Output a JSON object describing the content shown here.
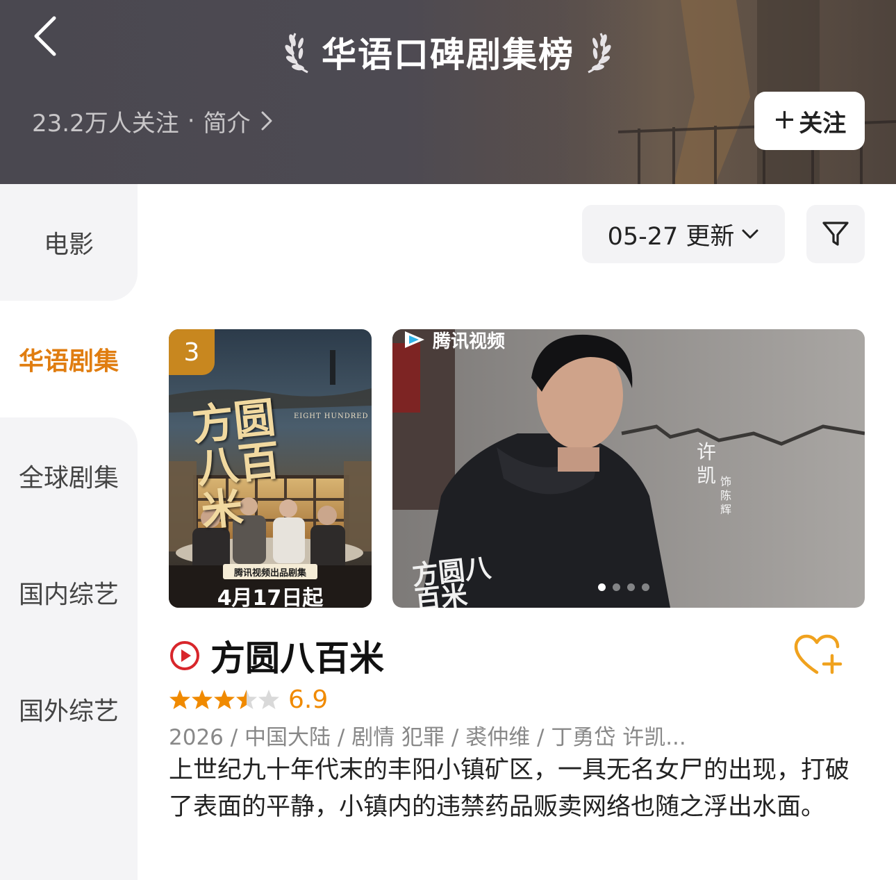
{
  "header": {
    "title": "华语口碑剧集榜",
    "followers": "23.2万人关注",
    "separator": "·",
    "intro_label": "简介",
    "follow_button": "关注",
    "follow_plus": "+"
  },
  "sidebar": {
    "items": [
      {
        "label": "电影",
        "active": false
      },
      {
        "label": "华语剧集",
        "active": true
      },
      {
        "label": "全球剧集",
        "active": false
      },
      {
        "label": "国内综艺",
        "active": false
      },
      {
        "label": "国外综艺",
        "active": false
      }
    ]
  },
  "toolbar": {
    "date_label": "05-27 更新",
    "filter_icon": "filter-icon"
  },
  "media": {
    "rank": "3",
    "poster_title": "方圆八百米",
    "poster_title_en": "EIGHT HUNDRED",
    "poster_tag": "腾讯视频出品剧集",
    "poster_date": "4月17日起",
    "platform": "腾讯视频",
    "cast_name": "许凯",
    "cast_role": "饰陈辉",
    "carousel_count": 4,
    "carousel_active": 0
  },
  "show": {
    "title": "方圆八百米",
    "rating": "6.9",
    "stars_filled": 3.5,
    "stars_total": 5,
    "meta": "2026 / 中国大陆 / 剧情 犯罪 / 裘仲维 / 丁勇岱 许凯...",
    "description": "上世纪九十年代末的丰阳小镇矿区，一具无名女尸的出现，打破了表面的平静，小镇内的违禁药品贩卖网络也随之浮出水面。"
  },
  "colors": {
    "accent": "#e07d10",
    "rating": "#f08a00",
    "play_icon": "#d8262b",
    "badge": "#c8871f"
  }
}
